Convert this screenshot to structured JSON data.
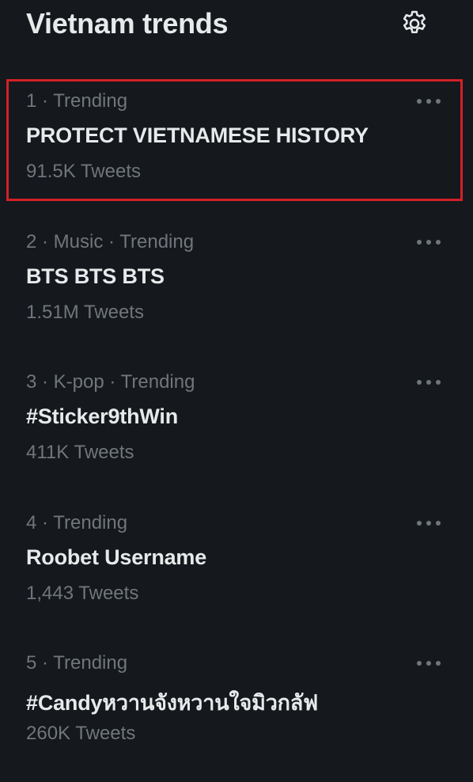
{
  "header": {
    "title": "Vietnam trends",
    "settings_icon": "gear-icon"
  },
  "trends": [
    {
      "meta": "1 · Trending",
      "name": "PROTECT VIETNAMESE HISTORY",
      "count": "91.5K Tweets",
      "highlighted": true
    },
    {
      "meta": "2 · Music · Trending",
      "name": "BTS BTS BTS",
      "count": "1.51M Tweets",
      "highlighted": false
    },
    {
      "meta": "3 · K-pop · Trending",
      "name": "#Sticker9thWin",
      "count": "411K Tweets",
      "highlighted": false
    },
    {
      "meta": "4 · Trending",
      "name": "Roobet Username",
      "count": "1,443 Tweets",
      "highlighted": false
    },
    {
      "meta": "5 · Trending",
      "name": "#Candyหวานจังหวานใจมิวกลัฟ",
      "count": "260K Tweets",
      "highlighted": false
    }
  ],
  "colors": {
    "background": "#15181c",
    "primary_text": "#e7e9ea",
    "secondary_text": "#71767b",
    "highlight_border": "#d32027"
  }
}
